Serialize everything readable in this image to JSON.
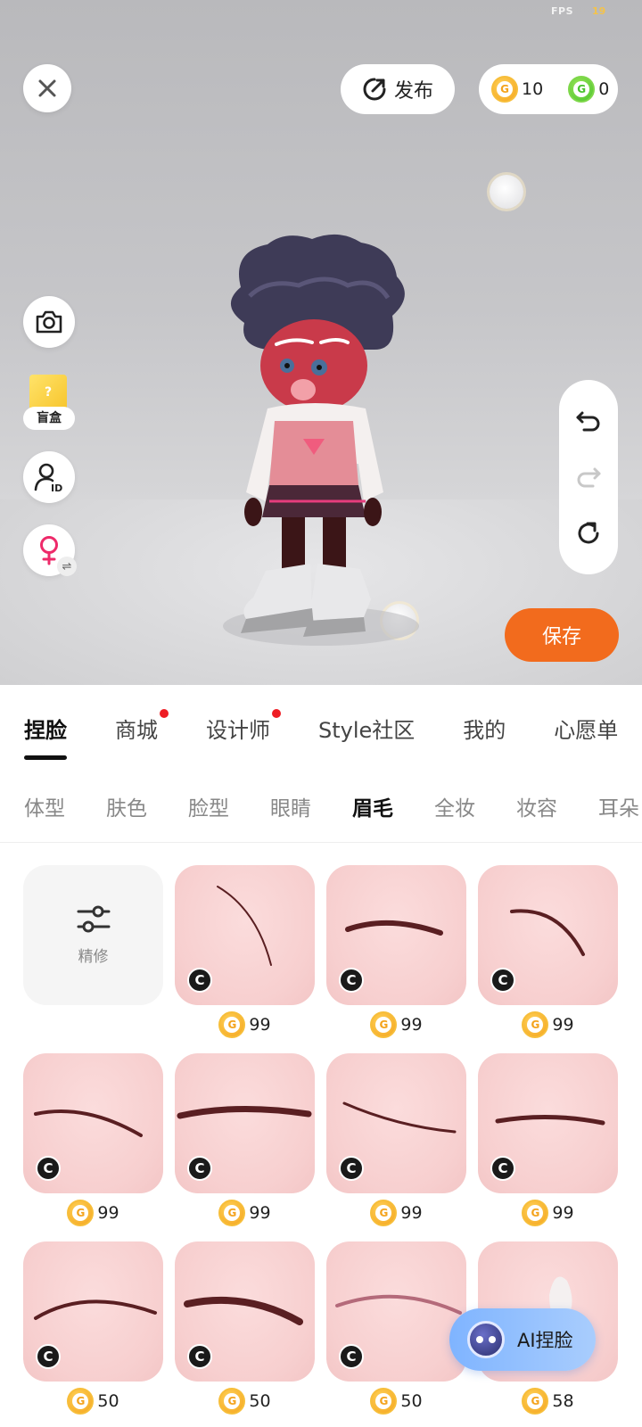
{
  "status": {
    "fps_label": "FPS",
    "fps_value": "19"
  },
  "top_bar": {
    "publish_label": "发布",
    "gold_coins": "10",
    "green_coins": "0"
  },
  "side_tools": {
    "blind_box_label": "盲盒"
  },
  "save_label": "保存",
  "main_tabs": [
    {
      "label": "捏脸",
      "active": true,
      "dot": false
    },
    {
      "label": "商城",
      "active": false,
      "dot": true
    },
    {
      "label": "设计师",
      "active": false,
      "dot": true
    },
    {
      "label": "Style社区",
      "active": false,
      "dot": false
    },
    {
      "label": "我的",
      "active": false,
      "dot": false
    },
    {
      "label": "心愿单",
      "active": false,
      "dot": false
    }
  ],
  "sub_tabs": [
    {
      "label": "体型",
      "active": false
    },
    {
      "label": "肤色",
      "active": false
    },
    {
      "label": "脸型",
      "active": false
    },
    {
      "label": "眼睛",
      "active": false
    },
    {
      "label": "眉毛",
      "active": true
    },
    {
      "label": "全妆",
      "active": false
    },
    {
      "label": "妆容",
      "active": false
    },
    {
      "label": "耳朵",
      "active": false
    }
  ],
  "refine_label": "精修",
  "items": [
    {
      "price": "99",
      "badge": "C"
    },
    {
      "price": "99",
      "badge": "C"
    },
    {
      "price": "99",
      "badge": "C"
    },
    {
      "price": "99",
      "badge": "C"
    },
    {
      "price": "99",
      "badge": "C"
    },
    {
      "price": "99",
      "badge": "C"
    },
    {
      "price": "99",
      "badge": "C"
    },
    {
      "price": "50",
      "badge": "C"
    },
    {
      "price": "50",
      "badge": "C"
    },
    {
      "price": "50",
      "badge": "C"
    },
    {
      "price": "58",
      "badge": ""
    }
  ],
  "ai_button_label": "AI捏脸",
  "colors": {
    "accent_orange": "#f26b1d",
    "active_dot": "#ee1d24",
    "card_pink": "#f8d3d3",
    "gold_coin": "#f4a31c",
    "green_coin": "#46c22c"
  }
}
